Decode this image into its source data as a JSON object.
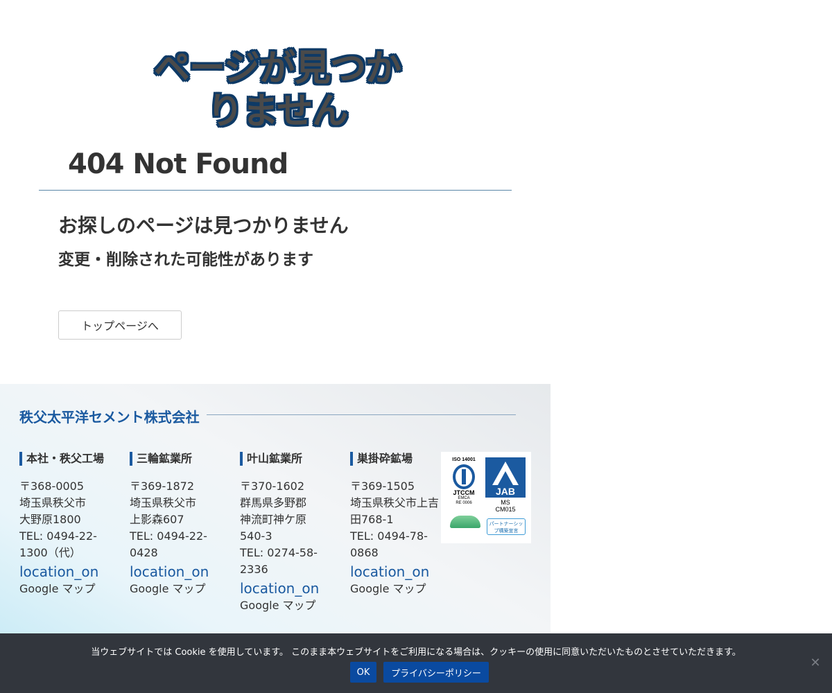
{
  "page": {
    "hero_title": "ページが見つかりません",
    "not_found": "404 Not Found",
    "heading": "お探しのページは見つかりません",
    "subheading": "変更・削除された可能性があります",
    "top_button": "トップページへ"
  },
  "footer": {
    "company": "秩父太平洋セメント株式会社",
    "offices": [
      {
        "name": "本社・秩父工場",
        "address": [
          "〒368-0005",
          "埼玉県秩父市",
          "大野原1800"
        ],
        "tel": "TEL: 0494-22-1300（代）",
        "location_icon": "location_on",
        "map_link": "Google マップ"
      },
      {
        "name": "三輪鉱業所",
        "address": [
          "〒369-1872",
          "埼玉県秩父市",
          "上影森607"
        ],
        "tel": "TEL: 0494-22-0428",
        "location_icon": "location_on",
        "map_link": "Google マップ"
      },
      {
        "name": "叶山鉱業所",
        "address": [
          "〒370-1602",
          "群馬県多野郡",
          "神流町神ケ原",
          "540-3"
        ],
        "tel": "TEL: 0274-58-2336",
        "location_icon": "location_on",
        "map_link": "Google マップ"
      },
      {
        "name": "巣掛砕鉱場",
        "address": [
          "〒369-1505",
          "埼玉県秩父市上吉田768-1"
        ],
        "tel": "TEL: 0494-78-0868",
        "location_icon": "location_on",
        "map_link": "Google マップ"
      }
    ],
    "certs": {
      "iso": "ISO 14001",
      "jtccm": "JTCCM",
      "emca": "EMCA",
      "re": "RE 0006",
      "jab": "JAB",
      "ms": "MS",
      "cm": "CM015",
      "partner": "パートナーシップ構築宣言"
    }
  },
  "cookie": {
    "message": "当ウェブサイトでは Cookie を使用しています。 このまま本ウェブサイトをご利用になる場合は、クッキーの使用に同意いただいたものとさせていただきます。",
    "ok": "OK",
    "policy": "プライバシーポリシー",
    "close": "✕"
  },
  "colors": {
    "accent": "#1b5aa0",
    "title_outline": "#0e3a66",
    "cookie_bg": "#32363d",
    "cookie_button": "#0a4aa0"
  }
}
